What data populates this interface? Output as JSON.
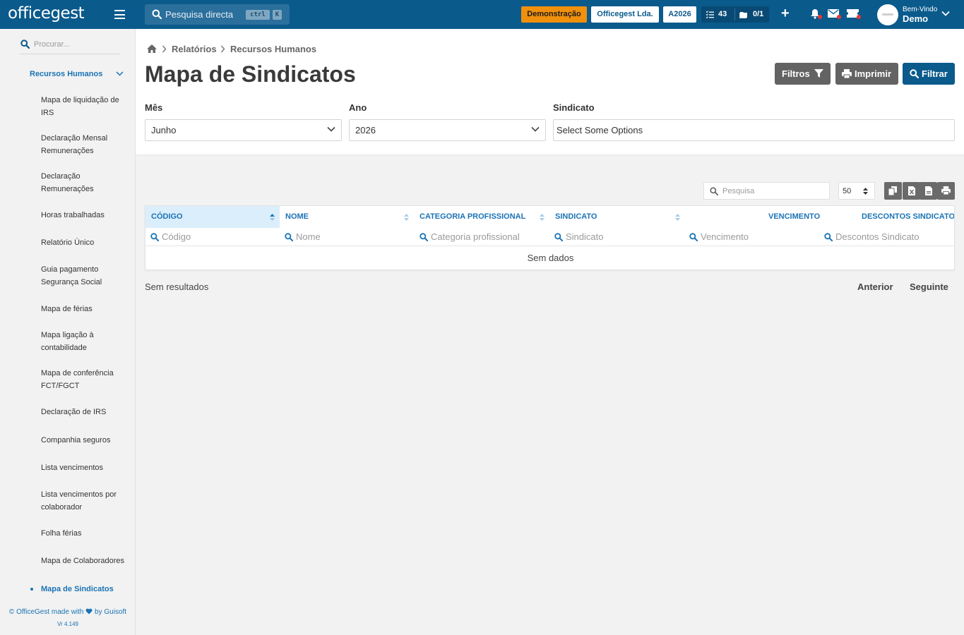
{
  "topbar": {
    "logo": "officegest",
    "search_placeholder": "Pesquisa directa",
    "kbd_ctrl": "ctrl",
    "kbd_k": "K",
    "demo_badge": "Demonstração",
    "company": "Officegest Lda.",
    "year": "A2026",
    "tasks_count": "43",
    "docs_count": "0/1",
    "welcome": "Bem-Vindo",
    "user": "Demo"
  },
  "sidebar": {
    "search_placeholder": "Procurar...",
    "section": "Recursos Humanos",
    "items": [
      "Mapa de liquidação de IRS",
      "Declaração Mensal Remunerações",
      "Declaração Remunerações",
      "Horas trabalhadas",
      "Relatório Único",
      "Guia pagamento Segurança Social",
      "Mapa de férias",
      "Mapa ligação à contabilidade",
      "Mapa de conferência FCT/FGCT",
      "Declaração de IRS",
      "Companhia seguros",
      "Lista vencimentos",
      "Lista vencimentos por colaborador",
      "Folha férias",
      "Mapa de Colaboradores",
      "Mapa de Sindicatos"
    ],
    "footer_left": "© OfficeGest made with",
    "footer_right": "by Guisoft",
    "version": "Vr 4.149"
  },
  "breadcrumb": [
    "Relatórios",
    "Recursos Humanos"
  ],
  "page": {
    "title": "Mapa de Sindicatos",
    "btn_filtros": "Filtros",
    "btn_imprimir": "Imprimir",
    "btn_filtrar": "Filtrar"
  },
  "filters": {
    "mes_label": "Mês",
    "mes_value": "Junho",
    "ano_label": "Ano",
    "ano_value": "2026",
    "sindicato_label": "Sindicato",
    "sindicato_placeholder": "Select Some Options"
  },
  "table": {
    "search_placeholder": "Pesquisa",
    "page_size": "50",
    "columns": [
      "CÓDIGO",
      "NOME",
      "CATEGORIA PROFISSIONAL",
      "SINDICATO",
      "VENCIMENTO",
      "DESCONTOS SINDICATO"
    ],
    "filter_placeholders": [
      "Código",
      "Nome",
      "Categoria profissional",
      "Sindicato",
      "Vencimento",
      "Descontos Sindicato"
    ],
    "empty": "Sem dados",
    "results": "Sem resultados",
    "prev": "Anterior",
    "next": "Seguinte"
  }
}
